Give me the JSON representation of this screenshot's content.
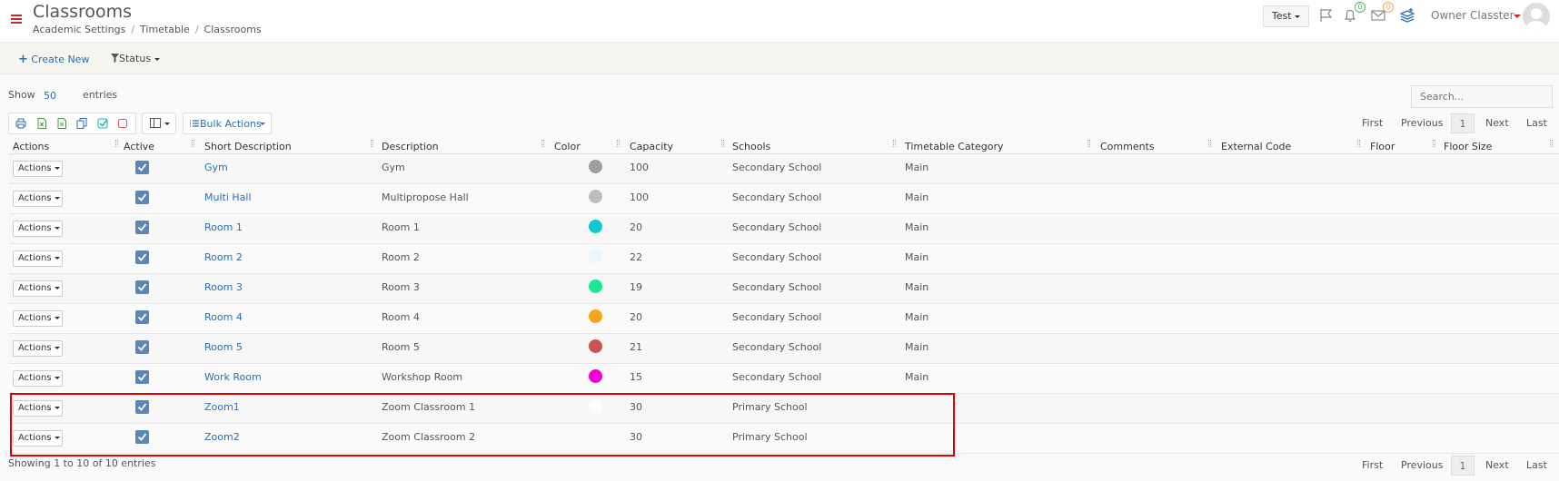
{
  "header": {
    "title": "Classrooms",
    "breadcrumb": [
      "Academic Settings",
      "Timetable",
      "Classrooms"
    ],
    "test_button": "Test",
    "notifications_count": "0",
    "messages_count": "0",
    "user_name": "Owner Classter"
  },
  "toolbar": {
    "create_new": "Create New",
    "status": "Status"
  },
  "table_controls": {
    "show_label": "Show",
    "page_size": "50",
    "entries_label": "entries",
    "search_placeholder": "Search...",
    "bulk_actions": "Bulk Actions",
    "pager": {
      "first": "First",
      "previous": "Previous",
      "current": "1",
      "next": "Next",
      "last": "Last"
    }
  },
  "columns": [
    "Actions",
    "Active",
    "Short Description",
    "Description",
    "Color",
    "Capacity",
    "Schools",
    "Timetable Category",
    "Comments",
    "External Code",
    "Floor",
    "Floor Size"
  ],
  "rows": [
    {
      "action": "Actions",
      "short": "Gym",
      "desc": "Gym",
      "color": "#9e9e9e",
      "capacity": "100",
      "school": "Secondary School",
      "category": "Main"
    },
    {
      "action": "Actions",
      "short": "Multi Hall",
      "desc": "Multipropose Hall",
      "color": "#bdbdbd",
      "capacity": "100",
      "school": "Secondary School",
      "category": "Main"
    },
    {
      "action": "Actions",
      "short": "Room 1",
      "desc": "Room 1",
      "color": "#12c7d2",
      "capacity": "20",
      "school": "Secondary School",
      "category": "Main"
    },
    {
      "action": "Actions",
      "short": "Room 2",
      "desc": "Room 2",
      "color": "#eef6fb",
      "capacity": "22",
      "school": "Secondary School",
      "category": "Main"
    },
    {
      "action": "Actions",
      "short": "Room 3",
      "desc": "Room 3",
      "color": "#1de88f",
      "capacity": "19",
      "school": "Secondary School",
      "category": "Main"
    },
    {
      "action": "Actions",
      "short": "Room 4",
      "desc": "Room 4",
      "color": "#f7a31c",
      "capacity": "20",
      "school": "Secondary School",
      "category": "Main"
    },
    {
      "action": "Actions",
      "short": "Room 5",
      "desc": "Room 5",
      "color": "#c85450",
      "capacity": "21",
      "school": "Secondary School",
      "category": "Main"
    },
    {
      "action": "Actions",
      "short": "Work Room",
      "desc": "Workshop Room",
      "color": "#f000d8",
      "capacity": "15",
      "school": "Secondary School",
      "category": "Main"
    },
    {
      "action": "Actions",
      "short": "Zoom1",
      "desc": "Zoom Classroom 1",
      "color": "#ffffff",
      "capacity": "30",
      "school": "Primary School",
      "category": ""
    },
    {
      "action": "Actions",
      "short": "Zoom2",
      "desc": "Zoom Classroom 2",
      "color": "#fafafa",
      "capacity": "30",
      "school": "Primary School",
      "category": ""
    }
  ],
  "footer": {
    "info": "Showing 1 to 10 of 10 entries"
  }
}
